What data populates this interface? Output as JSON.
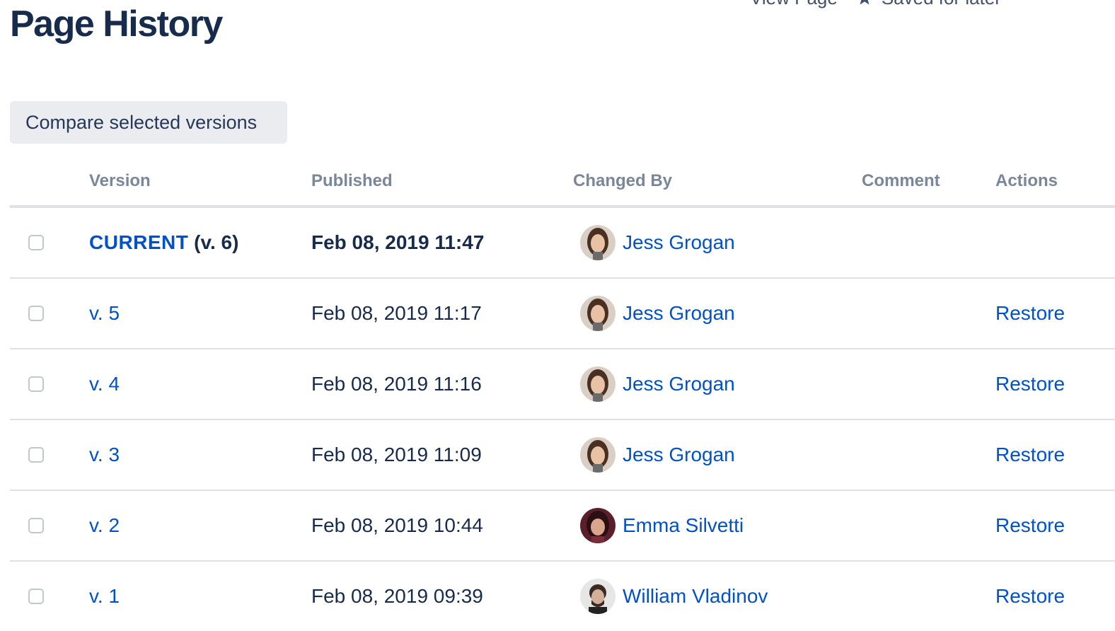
{
  "header": {
    "title": "Page History",
    "view_page_label": "View Page",
    "saved_label": "Saved for later"
  },
  "toolbar": {
    "compare_label": "Compare selected versions"
  },
  "table": {
    "columns": {
      "version": "Version",
      "published": "Published",
      "changed_by": "Changed By",
      "comment": "Comment",
      "actions": "Actions"
    },
    "rows": [
      {
        "version_label": "CURRENT",
        "version_suffix": " (v. 6)",
        "published": "Feb 08, 2019 11:47",
        "changed_by": "Jess Grogan",
        "avatar": "jess-avatar",
        "comment": "",
        "action": ""
      },
      {
        "version_label": "v. 5",
        "version_suffix": "",
        "published": "Feb 08, 2019 11:17",
        "changed_by": "Jess Grogan",
        "avatar": "jess-avatar",
        "comment": "",
        "action": "Restore"
      },
      {
        "version_label": "v. 4",
        "version_suffix": "",
        "published": "Feb 08, 2019 11:16",
        "changed_by": "Jess Grogan",
        "avatar": "jess-avatar",
        "comment": "",
        "action": "Restore"
      },
      {
        "version_label": "v. 3",
        "version_suffix": "",
        "published": "Feb 08, 2019 11:09",
        "changed_by": "Jess Grogan",
        "avatar": "jess-avatar",
        "comment": "",
        "action": "Restore"
      },
      {
        "version_label": "v. 2",
        "version_suffix": "",
        "published": "Feb 08, 2019 10:44",
        "changed_by": "Emma Silvetti",
        "avatar": "emma-avatar",
        "comment": "",
        "action": "Restore"
      },
      {
        "version_label": "v. 1",
        "version_suffix": "",
        "published": "Feb 08, 2019 09:39",
        "changed_by": "William Vladinov",
        "avatar": "william-avatar",
        "comment": "",
        "action": "Restore"
      }
    ]
  },
  "colors": {
    "link": "#0052cc",
    "text": "#172b4d",
    "header_text": "#7a869a",
    "button_bg": "#ebecf0",
    "border": "#dfe1e6"
  }
}
